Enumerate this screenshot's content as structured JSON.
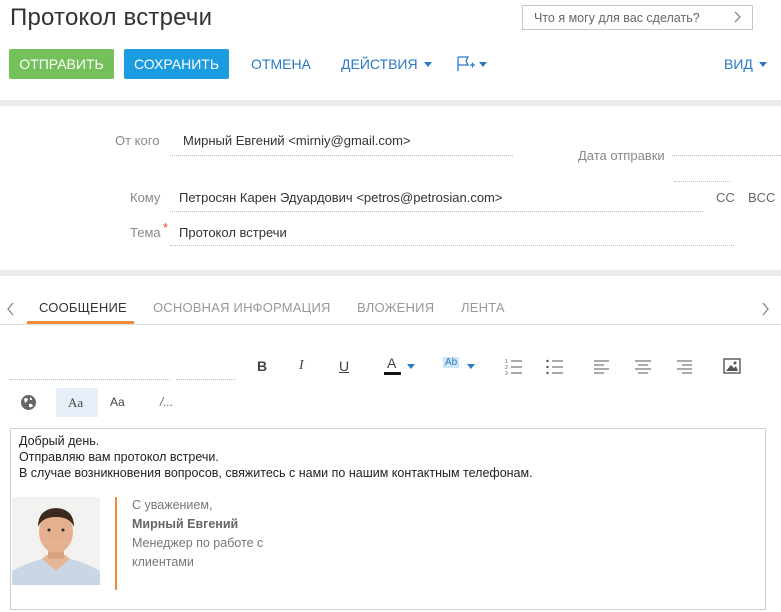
{
  "header": {
    "title": "Протокол встречи",
    "help_placeholder": "Что я могу для вас сделать?"
  },
  "toolbar": {
    "send_label": "ОТПРАВИТЬ",
    "save_label": "СОХРАНИТЬ",
    "cancel_label": "ОТМЕНА",
    "actions_label": "ДЕЙСТВИЯ",
    "view_label": "ВИД"
  },
  "fields": {
    "from_label": "От кого",
    "from_value": "Мирный Евгений <mirniy@gmail.com>",
    "sent_date_label": "Дата отправки",
    "sent_date_value": "",
    "to_label": "Кому",
    "to_value": "Петросян Карен Эдуардович <petros@petrosian.com>",
    "cc_label": "CC",
    "bcc_label": "BCC",
    "subject_label": "Тема",
    "subject_required": "*",
    "subject_value": "Протокол встречи"
  },
  "tabs": [
    "СООБЩЕНИЕ",
    "ОСНОВНАЯ ИНФОРМАЦИЯ",
    "ВЛОЖЕНИЯ",
    "ЛЕНТА"
  ],
  "editor_toolbar": {
    "bold": "B",
    "italic": "I",
    "underline": "U",
    "font_color": "A",
    "highlight": "Ab",
    "font_face": "Aa",
    "font_size": "Aa",
    "source": "/..."
  },
  "message": {
    "lines": [
      "Добрый день.",
      "Отправляю вам протокол встречи.",
      "В случае возникновения вопросов, свяжитесь с нами по нашим контактным телефонам."
    ],
    "signature": {
      "greeting": "С уважением,",
      "name": "Мирный Евгений",
      "position_line1": "Менеджер по работе с",
      "position_line2": "клиентами"
    }
  },
  "colors": {
    "send": "#74c05a",
    "save": "#1b9ce0",
    "link": "#2a79c4",
    "accent": "#f0883a"
  }
}
